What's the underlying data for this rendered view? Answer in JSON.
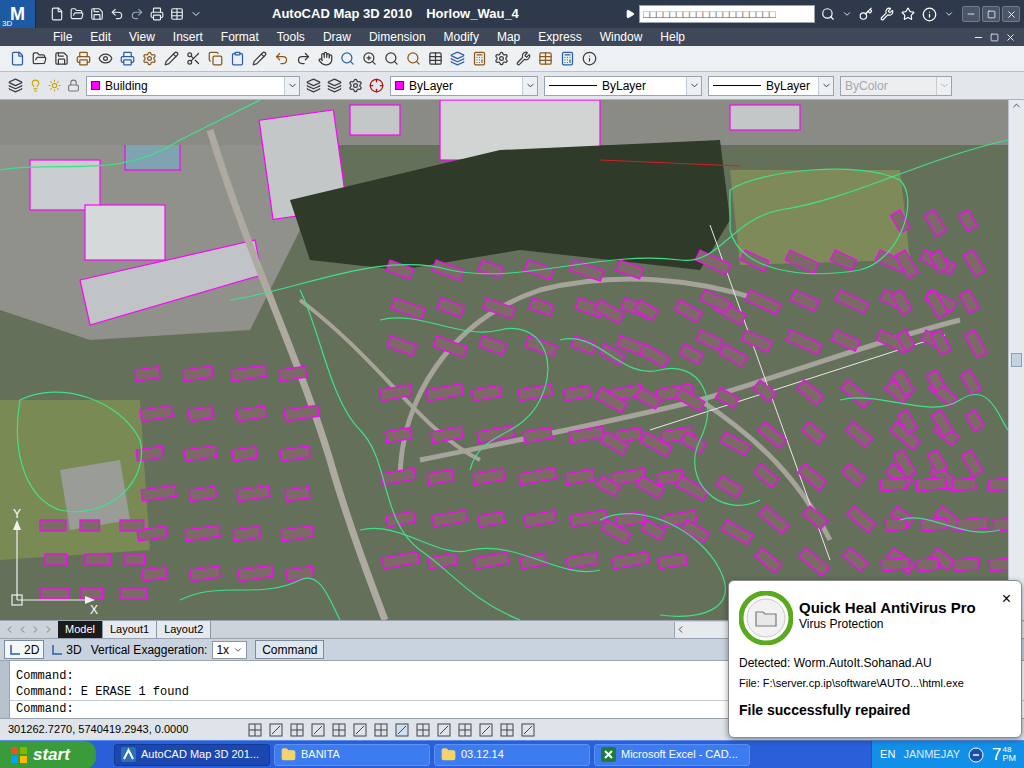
{
  "window": {
    "app_logo": "M",
    "app_badge": "3D",
    "title": "AutoCAD Map 3D 2010",
    "document": "Horlow_Wau_4"
  },
  "search": {
    "value": "□□□□□□□□□□□□□□□□□□□□"
  },
  "menu": [
    "File",
    "Edit",
    "View",
    "Insert",
    "Format",
    "Tools",
    "Draw",
    "Dimension",
    "Modify",
    "Map",
    "Express",
    "Window",
    "Help"
  ],
  "layer_toolbar": {
    "layer": {
      "label": "Building",
      "color": "#ff00ff"
    },
    "color": {
      "label": "ByLayer",
      "color": "#ff00ff"
    },
    "linetype": {
      "label": "ByLayer"
    },
    "lineweight": {
      "label": "ByLayer"
    },
    "plot_style": {
      "label": "ByColor",
      "disabled": true
    }
  },
  "ucs": {
    "x": "X",
    "y": "Y"
  },
  "layout_tabs": [
    {
      "label": "Model",
      "selected": true
    },
    {
      "label": "Layout1",
      "selected": false
    },
    {
      "label": "Layout2",
      "selected": false
    }
  ],
  "view_bar": {
    "modes": [
      {
        "label": "2D",
        "selected": true
      },
      {
        "label": "3D",
        "selected": false
      }
    ],
    "exaggeration_label": "Vertical Exaggeration:",
    "exaggeration": "1x",
    "command_button": "Command"
  },
  "command": {
    "history": [
      "Command:",
      "Command: E ERASE 1 found"
    ],
    "prompt": "Command:"
  },
  "status_bar": {
    "coordinates": "301262.7270, 5740419.2943, 0.0000"
  },
  "taskbar": {
    "start": "start",
    "tasks": [
      {
        "label": "AutoCAD Map 3D 201...",
        "kind": "autocad",
        "selected": true
      },
      {
        "label": "BANITA",
        "kind": "folder",
        "selected": false
      },
      {
        "label": "03.12.14",
        "kind": "folder",
        "selected": false
      },
      {
        "label": "Microsoft Excel - CAD...",
        "kind": "excel",
        "selected": false
      }
    ],
    "language": "EN",
    "user": "JANMEJAY",
    "clock": {
      "hour": "7",
      "minute": "48",
      "period": "PM"
    }
  },
  "notification": {
    "title": "Quick Heal AntiVirus Pro",
    "subtitle": "Virus Protection",
    "detected": "Detected: Worm.AutoIt.Sohanad.AU",
    "file": "File: F:\\server.cp.ip\\software\\AUTO...\\html.exe",
    "status": "File successfully repaired",
    "close": "×"
  }
}
